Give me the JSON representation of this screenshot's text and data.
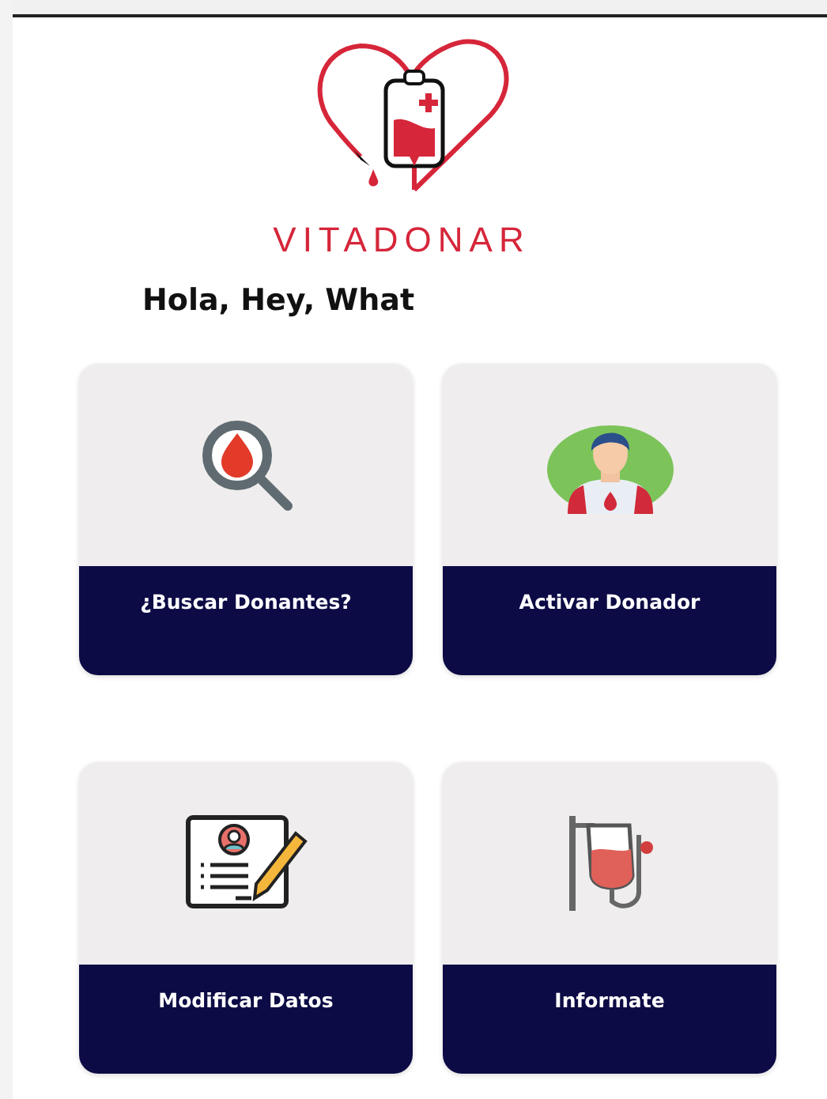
{
  "brand": {
    "name": "VITADONAR"
  },
  "greeting": "Hola, Hey, What",
  "cards": [
    {
      "kind": "search",
      "label": "¿Buscar Donantes?"
    },
    {
      "kind": "donor",
      "label": "Activar Donador"
    },
    {
      "kind": "edit",
      "label": "Modificar Datos"
    },
    {
      "kind": "info",
      "label": "Informate"
    }
  ]
}
